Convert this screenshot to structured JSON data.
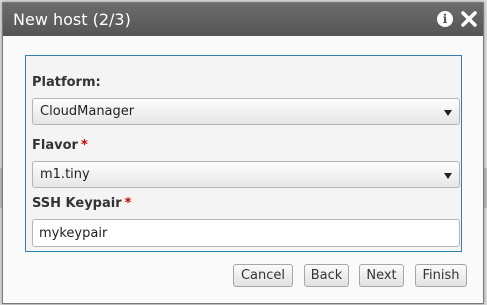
{
  "dialog": {
    "title": "New host (2/3)"
  },
  "icons": {
    "info": "info-icon",
    "close": "close-icon"
  },
  "form": {
    "platform": {
      "label": "Platform:",
      "value": "CloudManager"
    },
    "flavor": {
      "label": "Flavor",
      "required_mark": "*",
      "value": "m1.tiny"
    },
    "ssh_keypair": {
      "label": "SSH Keypair",
      "required_mark": "*",
      "value": "mykeypair"
    }
  },
  "buttons": {
    "cancel": "Cancel",
    "back": "Back",
    "next": "Next",
    "finish": "Finish"
  },
  "colors": {
    "titlebar": "#606060",
    "panel_border": "#2f7fb0",
    "required": "#cc0000"
  }
}
